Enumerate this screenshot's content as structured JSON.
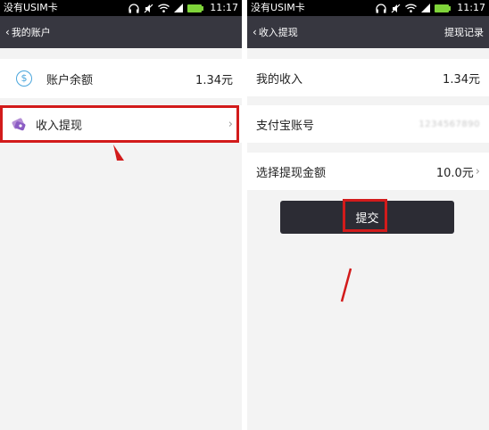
{
  "left": {
    "status": {
      "carrier": "没有USIM卡",
      "time": "11:17"
    },
    "title_bar": {
      "back_label": "我的账户"
    },
    "balance": {
      "icon": "dollar-coin-icon",
      "label": "账户余额",
      "value": "1.34元"
    },
    "withdraw": {
      "icon": "wallet-withdraw-icon",
      "label": "收入提现"
    }
  },
  "right": {
    "status": {
      "carrier": "没有USIM卡",
      "time": "11:17"
    },
    "title_bar": {
      "back_label": "收入提现",
      "action": "提现记录"
    },
    "income": {
      "label": "我的收入",
      "value": "1.34元"
    },
    "alipay": {
      "label": "支付宝账号",
      "value": "1234567890"
    },
    "amount": {
      "label": "选择提现金额",
      "value": "10.0元"
    },
    "submit_label": "提交"
  },
  "colors": {
    "title_bar": "#373740",
    "highlight": "#d21b1b",
    "accent": "#4aa6dc",
    "battery": "#7fd43a"
  }
}
